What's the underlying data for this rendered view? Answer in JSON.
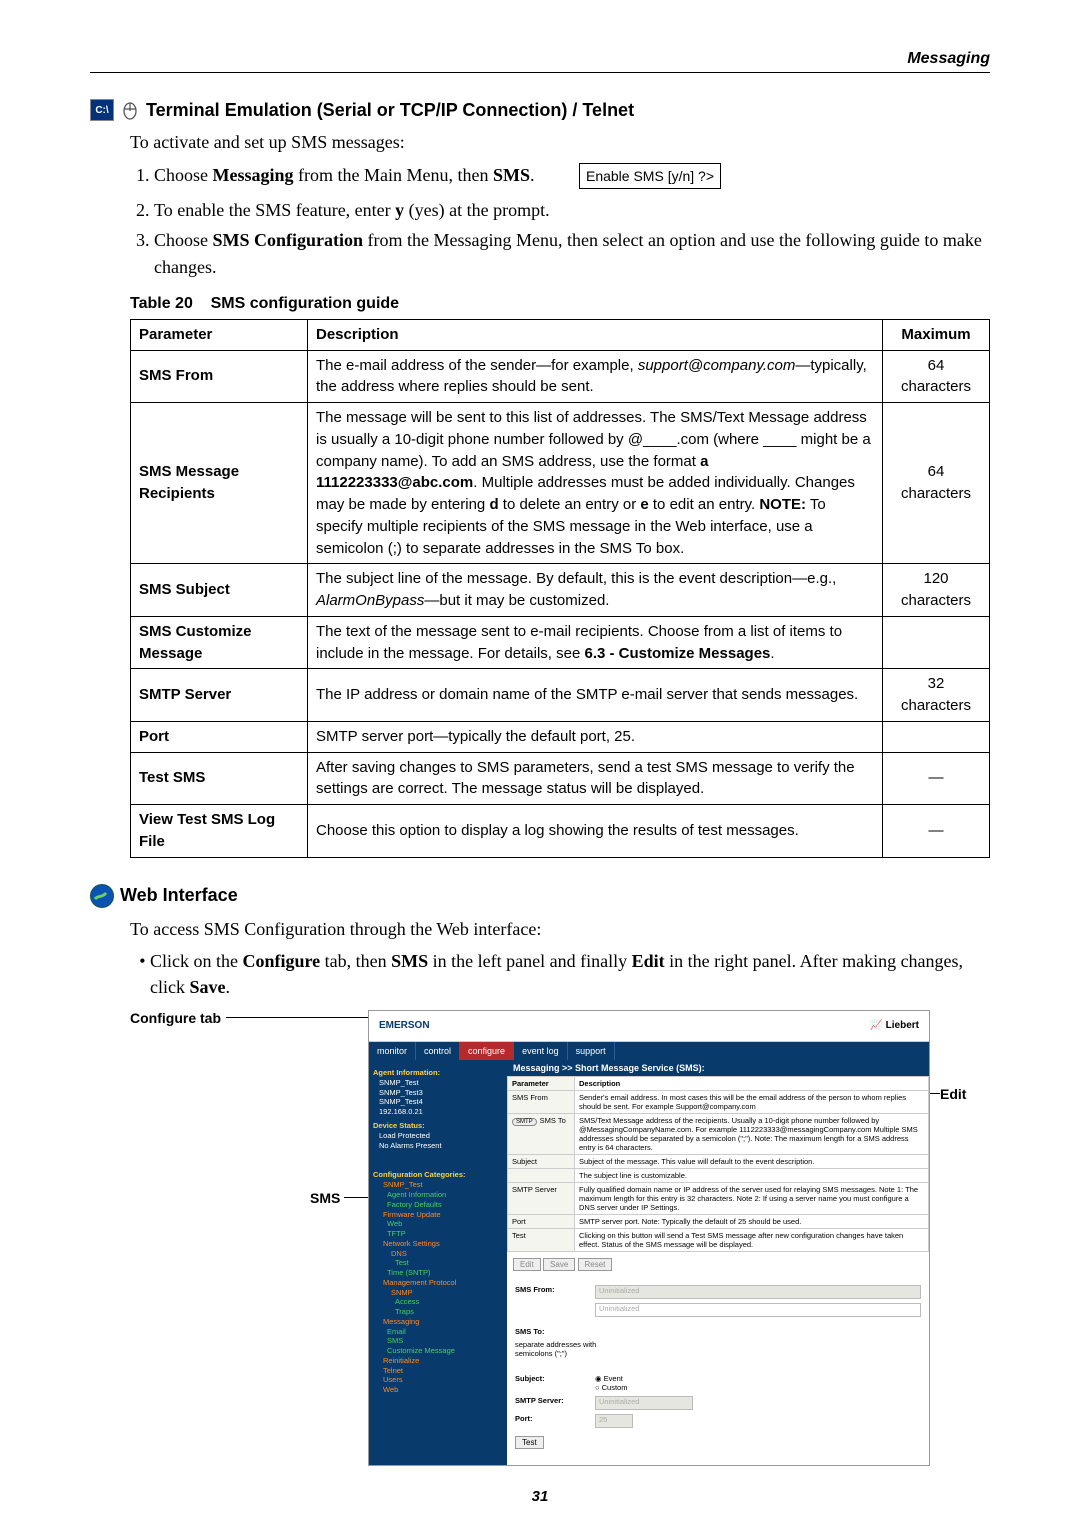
{
  "header_right": "Messaging",
  "sec1": {
    "title": "Terminal Emulation (Serial or TCP/IP Connection) / Telnet",
    "intro": "To activate and set up SMS messages:",
    "step1_pre": "Choose ",
    "step1_b1": "Messaging",
    "step1_mid": " from the Main Menu, then ",
    "step1_b2": "SMS",
    "step1_post": ".",
    "code": "Enable SMS [y/n] ?>",
    "step2_pre": "To enable the SMS feature, enter ",
    "step2_b": "y",
    "step2_post": " (yes) at the prompt.",
    "step3_pre": "Choose ",
    "step3_b": "SMS Configuration",
    "step3_post": " from the Messaging Menu, then select an option and use the following guide to make changes."
  },
  "table": {
    "caption_l": "Table 20",
    "caption_r": "SMS configuration guide",
    "head": {
      "c1": "Parameter",
      "c2": "Description",
      "c3": "Maximum"
    },
    "rows": [
      {
        "param": "SMS From",
        "desc_pre": "The e-mail address of the sender—for example, ",
        "desc_i": "support@company.com",
        "desc_post": "—typically, the address where replies should be sent.",
        "max": "64 characters"
      },
      {
        "param": "SMS Message Recipients",
        "desc_pre": "The message will be sent to this list of addresses. The SMS/Text Message address is usually a 10-digit phone number followed by @____.com (where ____ might be a company name). To add an SMS address, use the format ",
        "desc_b": "a 1112223333@abc.com",
        "desc_mid": ". Multiple addresses must be added individually. Changes may be made by entering ",
        "desc_b2": "d",
        "desc_mid2": " to delete an entry or ",
        "desc_b3": "e",
        "desc_mid3": " to edit an entry.\n",
        "desc_nb": "NOTE:",
        "desc_post": " To specify multiple recipients of the SMS message in the Web interface, use a semicolon (;) to separate addresses in the SMS To box.",
        "max": "64 characters"
      },
      {
        "param": "SMS Subject",
        "desc_pre": "The subject line of the message. By default, this is the event description—e.g., ",
        "desc_i": "AlarmOnBypass",
        "desc_post": "—but it may be customized.",
        "max": "120 characters"
      },
      {
        "param": "SMS Customize Message",
        "desc_pre": "The text of the message sent to e-mail recipients. Choose from a list of items to include in the message. For details, see ",
        "desc_b": "6.3 - Customize Messages",
        "desc_post": ".",
        "max": ""
      },
      {
        "param": "SMTP Server",
        "desc_pre": "The IP address or domain name of the SMTP e-mail server that sends messages.",
        "max": "32 characters"
      },
      {
        "param": "Port",
        "desc_pre": "SMTP server port—typically the default port, 25.",
        "max": ""
      },
      {
        "param": "Test SMS",
        "desc_pre": "After saving changes to SMS parameters, send a test SMS message to verify the settings are correct. The message status will be displayed.",
        "max": "—"
      },
      {
        "param": "View Test SMS Log File",
        "desc_pre": "Choose this option to display a log showing the results of test messages.",
        "max": "—"
      }
    ]
  },
  "sec2": {
    "title": "Web Interface",
    "intro": "To access SMS Configuration through the Web interface:",
    "b_pre": "Click on the ",
    "b1": "Configure",
    "b_mid1": " tab, then ",
    "b2": "SMS",
    "b_mid2": " in the left panel and finally ",
    "b3": "Edit",
    "b_mid3": " in the right panel. After making changes, click ",
    "b4": "Save",
    "b_post": "."
  },
  "fig": {
    "c_conf": "Configure tab",
    "c_sms": "SMS",
    "c_edit": "Edit",
    "logo": "EMERSON",
    "brand": "Liebert",
    "tabs": [
      "monitor",
      "control",
      "configure",
      "event log",
      "support"
    ],
    "bar": "Messaging >> Short Message Service (SMS):",
    "side": {
      "h1": "Agent Information:",
      "a1": "SNMP_Test",
      "a2": "SNMP_Test3",
      "a3": "SNMP_Test4",
      "a4": "192.168.0.21",
      "h2": "Device Status:",
      "d1": "Load Protected",
      "d2": "No Alarms Present",
      "h3": "Configuration Categories:",
      "c1": "SNMP_Test",
      "c2": "Agent Information",
      "c3": "Factory Defaults",
      "c4": "Firmware Update",
      "c5": "Web",
      "c6": "TFTP",
      "c7": "Network Settings",
      "c8": "DNS",
      "c9": "Test",
      "c10": "Time (SNTP)",
      "c11": "Management Protocol",
      "c12": "SNMP",
      "c13": "Access",
      "c14": "Traps",
      "c15": "Messaging",
      "c16": "Email",
      "c17": "SMS",
      "c18": "Customize Message",
      "c19": "Reinitialize",
      "c20": "Telnet",
      "c21": "Users",
      "c22": "Web"
    },
    "tbl": [
      {
        "p": "Parameter",
        "d": "Description"
      },
      {
        "p": "SMS From",
        "d": "Sender's email address.\nIn most cases this will be the email address of the person to whom replies should be sent. For example Support@company.com"
      },
      {
        "p": "SMS To",
        "d": "SMS/Text Message address of the recipients. Usually a 10-digit phone number followed by @MessagingCompanyName.com. For example 1112223333@messagingCompany.com\nMultiple SMS addresses should be separated by a semicolon (\";\").\nNote: The maximum length for a SMS address entry is 64 characters."
      },
      {
        "p": "Subject",
        "d": "Subject of the message. This value will default to the event description."
      },
      {
        "p": "",
        "d": "The subject line is customizable."
      },
      {
        "p": "SMTP Server",
        "d": "Fully qualified domain name or IP address of the server used for relaying SMS messages.\nNote 1: The maximum length for this entry is 32 characters.\nNote 2: If using a server name you must configure a DNS server under IP Settings."
      },
      {
        "p": "Port",
        "d": "SMTP server port.\nNote: Typically the default of 25 should be used."
      },
      {
        "p": "Test",
        "d": "Clicking on this button will send a Test SMS message after new configuration changes have taken effect. Status of the SMS message will be displayed."
      }
    ],
    "btns": [
      "Edit",
      "Save",
      "Reset"
    ],
    "form": {
      "smsfrom": "SMS From:",
      "placeholder": "Uninitialized",
      "smsto": "SMS To:",
      "sep": "separate addresses with semicolons (\";\")",
      "subject": "Subject:",
      "opt1": "Event",
      "opt2": "Custom",
      "smtp": "SMTP Server:",
      "smtp_val": "Uninitialized",
      "port": "Port:",
      "port_val": "25",
      "test": "Test"
    }
  },
  "page_no": "31"
}
